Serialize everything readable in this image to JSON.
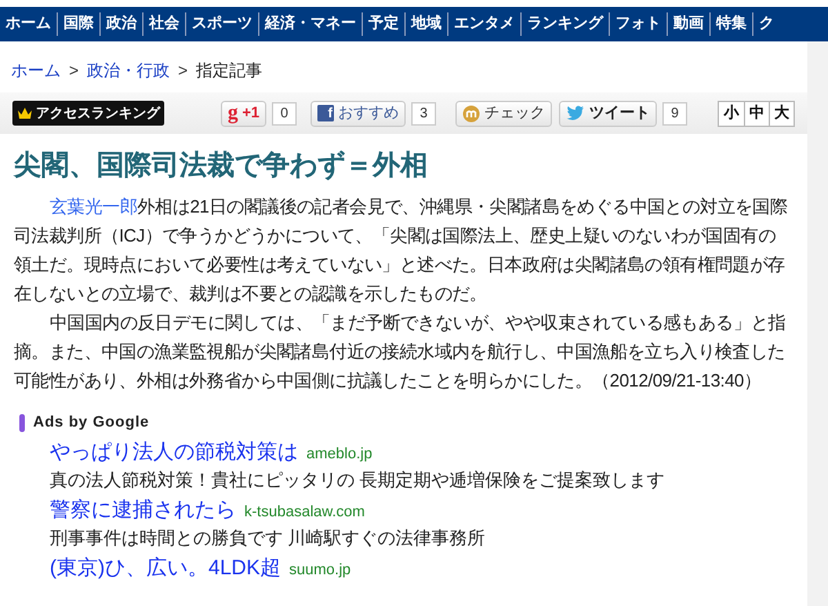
{
  "nav": [
    {
      "label": "ホーム"
    },
    {
      "label": "国際"
    },
    {
      "label": "政治"
    },
    {
      "label": "社会"
    },
    {
      "label": "スポーツ"
    },
    {
      "label": "経済・マネー"
    },
    {
      "label": "予定"
    },
    {
      "label": "地域"
    },
    {
      "label": "エンタメ"
    },
    {
      "label": "ランキング"
    },
    {
      "label": "フォト"
    },
    {
      "label": "動画"
    },
    {
      "label": "特集"
    },
    {
      "label": "ク"
    }
  ],
  "breadcrumb": [
    {
      "label": "ホーム",
      "link": true
    },
    {
      "label": "政治・行政",
      "link": true
    },
    {
      "label": "指定記事",
      "link": false
    }
  ],
  "breadcrumb_separators": [
    ">",
    ">"
  ],
  "toolbar": {
    "ranking_button": "アクセスランキング",
    "social": [
      {
        "kind": "gplus",
        "icon_text": "g",
        "label": "+1",
        "count": "0"
      },
      {
        "kind": "facebook",
        "icon_text": "f",
        "label": "おすすめ",
        "count": "3"
      },
      {
        "kind": "mixi",
        "label": "チェック"
      },
      {
        "kind": "twitter",
        "label": "ツイート",
        "count": "9"
      }
    ],
    "font_sizes": [
      "小",
      "中",
      "大"
    ]
  },
  "article": {
    "title": "尖閣、国際司法裁で争わず＝外相",
    "paragraphs": [
      {
        "link": "玄葉光一郎",
        "text": "外相は21日の閣議後の記者会見で、沖縄県・尖閣諸島をめぐる中国との対立を国際司法裁判所（ICJ）で争うかどうかについて、「尖閣は国際法上、歴史上疑いのないわが国固有の領土だ。現時点において必要性は考えていない」と述べた。日本政府は尖閣諸島の領有権問題が存在しないとの立場で、裁判は不要との認識を示したものだ。"
      },
      {
        "text": "中国国内の反日デモに関しては、「まだ予断できないが、やや収束されている感もある」と指摘。また、中国の漁業監視船が尖閣諸島付近の接続水域内を航行し、中国漁船を立ち入り検査した可能性があり、外相は外務省から中国側に抗議したことを明らかにした。（2012/09/21-13:40）"
      }
    ]
  },
  "ads": {
    "heading": "Ads by Google",
    "items": [
      {
        "title": "やっぱり法人の節税対策は",
        "domain": "ameblo.jp",
        "text": "真の法人節税対策！貴社にピッタリの 長期定期や逓増保険をご提案致します"
      },
      {
        "title": "警察に逮捕されたら",
        "domain": "k-tsubasalaw.com",
        "text": "刑事事件は時間との勝負です 川崎駅すぐの法律事務所"
      },
      {
        "title": "(東京)ひ、広い。4LDK超",
        "domain": "suumo.jp"
      }
    ]
  }
}
